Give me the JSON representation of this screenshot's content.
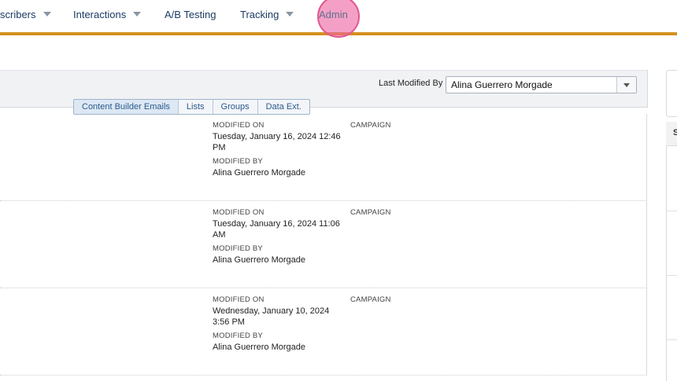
{
  "nav": {
    "items": [
      {
        "label": "scribers"
      },
      {
        "label": "Interactions"
      },
      {
        "label": "A/B Testing"
      },
      {
        "label": "Tracking"
      },
      {
        "label": "Admin"
      }
    ]
  },
  "toolbar": {
    "last_modified_label": "Last Modified By",
    "last_modified_value": "Alina Guerrero Morgade"
  },
  "tabs": [
    "Content Builder Emails",
    "Lists",
    "Groups",
    "Data Ext."
  ],
  "rows": [
    {
      "modified_on_label": "MODIFIED ON",
      "modified_on": "Tuesday, January 16, 2024 12:46 PM",
      "modified_by_label": "MODIFIED BY",
      "modified_by": "Alina Guerrero Morgade",
      "campaign_label": "CAMPAIGN"
    },
    {
      "modified_on_label": "MODIFIED ON",
      "modified_on": "Tuesday, January 16, 2024 11:06 AM",
      "modified_by_label": "MODIFIED BY",
      "modified_by": "Alina Guerrero Morgade",
      "campaign_label": "CAMPAIGN"
    },
    {
      "modified_on_label": "MODIFIED ON",
      "modified_on": "Wednesday, January 10, 2024 3:56 PM",
      "modified_by_label": "MODIFIED BY",
      "modified_by": "Alina Guerrero Morgade",
      "campaign_label": "CAMPAIGN"
    }
  ],
  "right_panel": {
    "header": "S"
  },
  "colors": {
    "nav_underline": "#d4911e",
    "highlight": "#ec60a0",
    "nav_text": "#1b3a64"
  }
}
